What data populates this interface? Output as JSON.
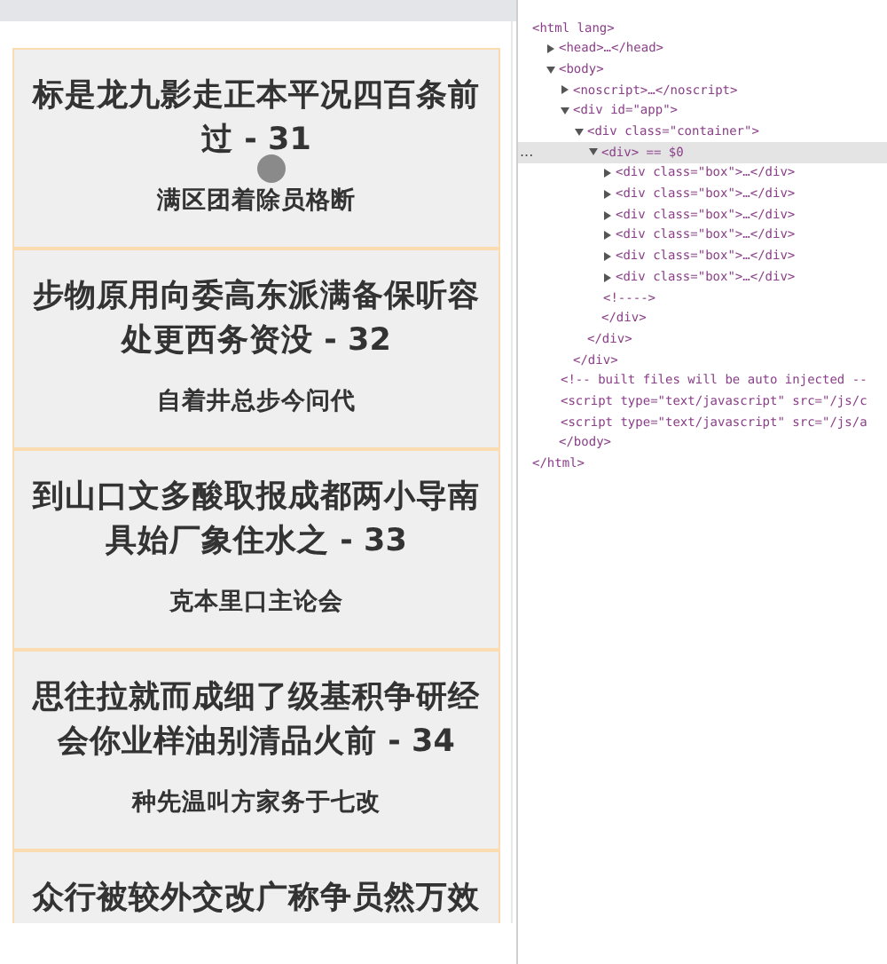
{
  "cards": [
    {
      "title": "标是龙九影走正本平况四百条前过 - 31",
      "subtitle": "满区团着除员格断"
    },
    {
      "title": "步物原用向委高东派满备保听容处更西务资没 - 32",
      "subtitle": "自着井总步今问代"
    },
    {
      "title": "到山口文多酸取报成都两小导南具始厂象住水之 - 33",
      "subtitle": "克本里口主论会"
    },
    {
      "title": "思往拉就而成细了级基积争研经会你业样油别清品火前 - 34",
      "subtitle": "种先温叫方家务于七改"
    },
    {
      "title": "众行被较外交改广称争员然万效"
    }
  ],
  "elements": [
    {
      "open": "<html lang>",
      "selected": false,
      "children": [
        {
          "open": "<head>…</head>",
          "expanded": false,
          "selected": false
        },
        {
          "open": "<body>",
          "expanded": true,
          "selected": false,
          "close": "</body>",
          "children": [
            {
              "open": "<noscript>…</noscript>",
              "expanded": false,
              "selected": false
            },
            {
              "open": "<div id=\"app\">",
              "expanded": true,
              "selected": false,
              "close": "</div>",
              "children": [
                {
                  "open": "<div class=\"container\">",
                  "expanded": true,
                  "selected": false,
                  "close": "</div>",
                  "children": [
                    {
                      "open": "<div> == $0",
                      "gutter": "...",
                      "expanded": true,
                      "selected": true,
                      "close": "</div>",
                      "children": [
                        {
                          "open": "<div class=\"box\">…</div>",
                          "expanded": false,
                          "selected": false
                        },
                        {
                          "open": "<div class=\"box\">…</div>",
                          "expanded": false,
                          "selected": false
                        },
                        {
                          "open": "<div class=\"box\">…</div>",
                          "expanded": false,
                          "selected": false
                        },
                        {
                          "open": "<div class=\"box\">…</div>",
                          "expanded": false,
                          "selected": false
                        },
                        {
                          "open": "<div class=\"box\">…</div>",
                          "expanded": false,
                          "selected": false
                        },
                        {
                          "open": "<div class=\"box\">…</div>",
                          "expanded": false,
                          "selected": false
                        },
                        {
                          "open": "<!---->",
                          "selected": false
                        }
                      ]
                    }
                  ]
                }
              ]
            },
            {
              "open": "<!-- built files will be auto injected --",
              "selected": false
            },
            {
              "open": "<script type=\"text/javascript\" src=\"/js/c",
              "selected": false
            },
            {
              "open": "<script type=\"text/javascript\" src=\"/js/a",
              "selected": false
            }
          ]
        }
      ]
    },
    {
      "open": "</html>",
      "selected": false
    }
  ]
}
